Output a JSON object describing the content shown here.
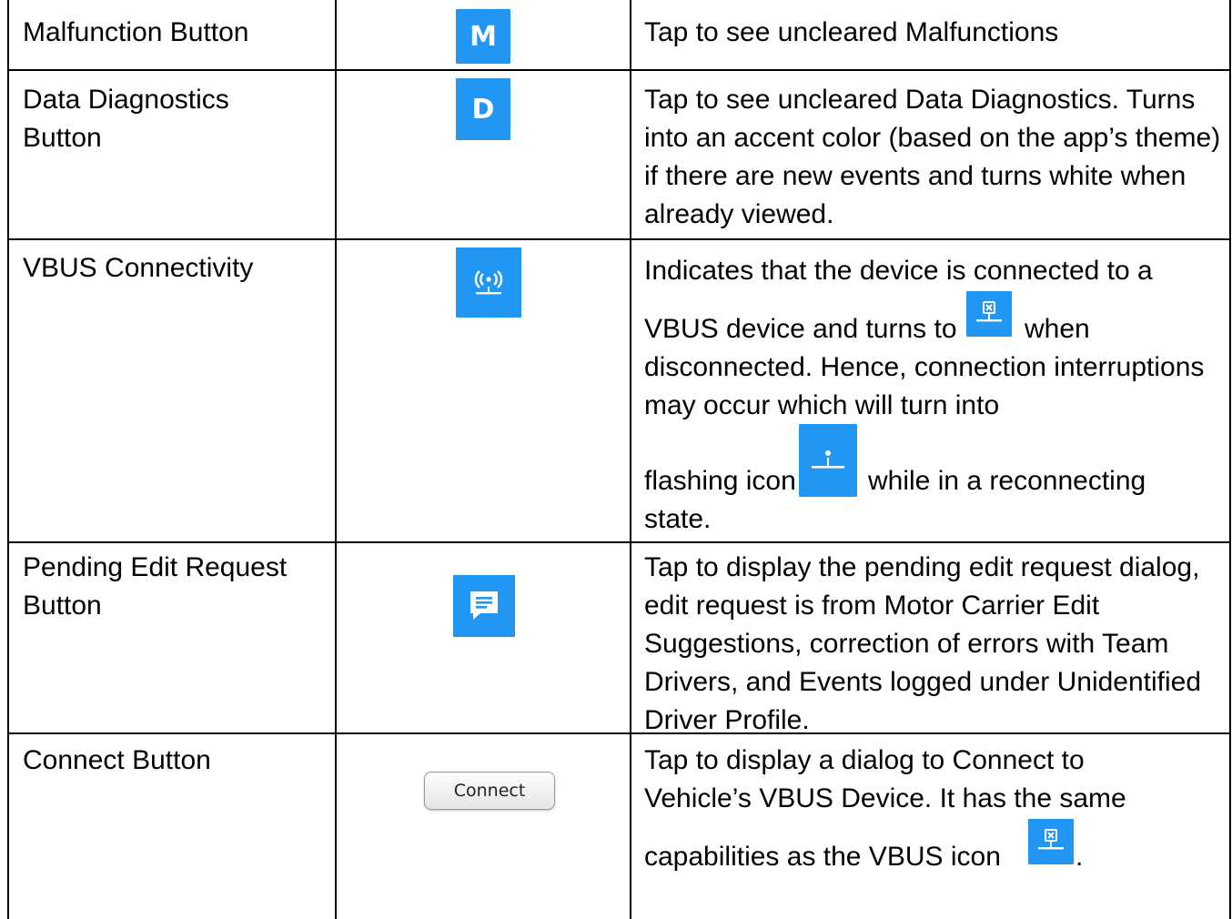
{
  "rows": [
    {
      "label": "Malfunction Button",
      "icon": "malfunction-m-icon",
      "icon_letter": "M",
      "description": "Tap to see uncleared Malfunctions"
    },
    {
      "label": "Data Diagnostics Button",
      "icon": "data-diagnostics-d-icon",
      "icon_letter": "D",
      "description": "Tap to see uncleared Data Diagnostics. Turns into an accent color (based on the app’s theme) if there are new events and turns white when already viewed."
    },
    {
      "label": "VBUS Connectivity",
      "icon": "vbus-connected-icon",
      "description_part1": "Indicates that the device is connected to a VBUS device and turns to",
      "inline_icon_1": "vbus-disconnected-icon",
      "description_part2": "when disconnected. Hence, connection interruptions may occur which will turn into flashing icon",
      "inline_icon_2": "vbus-reconnecting-icon",
      "description_part3": "while in a reconnecting state."
    },
    {
      "label": "Pending Edit Request Button",
      "icon": "pending-edit-request-icon",
      "description": "Tap to display the pending edit request dialog, edit request is from Motor Carrier Edit Suggestions, correction of errors with Team Drivers, and Events logged under Unidentified Driver Profile."
    },
    {
      "label": "Connect Button",
      "button_label": "Connect",
      "description_part1": "Tap to display a dialog to Connect to Vehicle’s VBUS Device. It has the same capabilities as the VBUS icon",
      "inline_icon": "vbus-disconnected-icon",
      "description_part2": "."
    }
  ],
  "colors": {
    "icon_blue": "#2196f3",
    "border": "#000000",
    "text": "#000000"
  }
}
